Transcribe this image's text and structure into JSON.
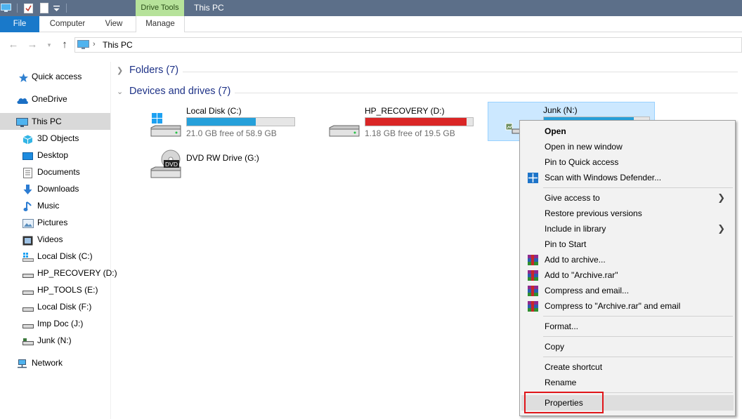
{
  "titlebar": {
    "context_tab": "Drive Tools",
    "title": "This PC"
  },
  "ribbon": {
    "tabs": [
      {
        "label": "File"
      },
      {
        "label": "Computer"
      },
      {
        "label": "View"
      },
      {
        "label": "Manage"
      }
    ]
  },
  "address": {
    "path": "This PC"
  },
  "navpane": {
    "items": [
      {
        "label": "Quick access",
        "icon": "star-icon"
      },
      {
        "label": "OneDrive",
        "icon": "cloud-icon"
      },
      {
        "label": "This PC",
        "icon": "computer-icon"
      },
      {
        "label": "3D Objects",
        "icon": "cube-icon"
      },
      {
        "label": "Desktop",
        "icon": "desktop-icon"
      },
      {
        "label": "Documents",
        "icon": "document-icon"
      },
      {
        "label": "Downloads",
        "icon": "download-icon"
      },
      {
        "label": "Music",
        "icon": "music-icon"
      },
      {
        "label": "Pictures",
        "icon": "picture-icon"
      },
      {
        "label": "Videos",
        "icon": "video-icon"
      },
      {
        "label": "Local Disk (C:)",
        "icon": "windows-drive-icon"
      },
      {
        "label": "HP_RECOVERY (D:)",
        "icon": "drive-icon"
      },
      {
        "label": "HP_TOOLS (E:)",
        "icon": "drive-icon"
      },
      {
        "label": "Local Disk (F:)",
        "icon": "drive-icon"
      },
      {
        "label": "Imp Doc (J:)",
        "icon": "drive-icon"
      },
      {
        "label": "Junk (N:)",
        "icon": "network-drive-icon"
      },
      {
        "label": "Network",
        "icon": "network-icon"
      }
    ]
  },
  "content": {
    "folders_header": "Folders (7)",
    "devices_header": "Devices and drives (7)",
    "drives": [
      {
        "name": "Local Disk (C:)",
        "free": "21.0 GB free of 58.9 GB",
        "used_fraction": 0.64,
        "bar_color": "#26a0da"
      },
      {
        "name": "HP_RECOVERY (D:)",
        "free": "1.18 GB free of 19.5 GB",
        "used_fraction": 0.94,
        "bar_color": "#da2626"
      },
      {
        "name": "Junk (N:)",
        "free": "",
        "used_fraction": 0.85,
        "bar_color": "#26a0da"
      },
      {
        "name": "DVD RW Drive (G:)",
        "free": ""
      }
    ],
    "dvd_label": "DVD"
  },
  "context_menu": {
    "items": [
      {
        "label": "Open",
        "bold": true
      },
      {
        "label": "Open in new window"
      },
      {
        "label": "Pin to Quick access"
      },
      {
        "label": "Scan with Windows Defender...",
        "icon": "defender-icon"
      },
      {
        "label": "Give access to",
        "submenu": true
      },
      {
        "label": "Restore previous versions"
      },
      {
        "label": "Include in library",
        "submenu": true
      },
      {
        "label": "Pin to Start"
      },
      {
        "label": "Add to archive...",
        "icon": "winrar-icon"
      },
      {
        "label": "Add to \"Archive.rar\"",
        "icon": "winrar-icon"
      },
      {
        "label": "Compress and email...",
        "icon": "winrar-icon"
      },
      {
        "label": "Compress to \"Archive.rar\" and email",
        "icon": "winrar-icon"
      },
      {
        "label": "Format..."
      },
      {
        "label": "Copy"
      },
      {
        "label": "Create shortcut"
      },
      {
        "label": "Rename"
      },
      {
        "label": "Properties",
        "highlighted": true
      }
    ]
  }
}
